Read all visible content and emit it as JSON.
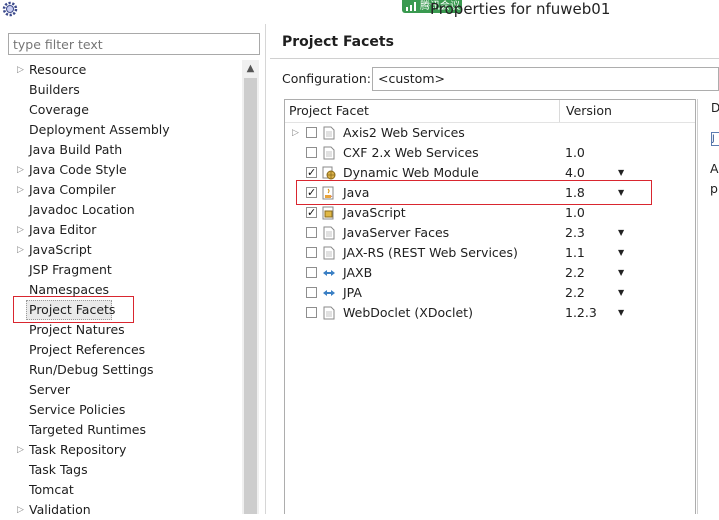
{
  "window": {
    "title": "Properties for nfuweb01",
    "meeting_badge": "腾讯会议"
  },
  "filter": {
    "placeholder": "type filter text"
  },
  "tree": [
    {
      "label": "Resource",
      "expandable": true
    },
    {
      "label": "Builders",
      "expandable": false
    },
    {
      "label": "Coverage",
      "expandable": false
    },
    {
      "label": "Deployment Assembly",
      "expandable": false
    },
    {
      "label": "Java Build Path",
      "expandable": false
    },
    {
      "label": "Java Code Style",
      "expandable": true
    },
    {
      "label": "Java Compiler",
      "expandable": true
    },
    {
      "label": "Javadoc Location",
      "expandable": false
    },
    {
      "label": "Java Editor",
      "expandable": true
    },
    {
      "label": "JavaScript",
      "expandable": true
    },
    {
      "label": "JSP Fragment",
      "expandable": false
    },
    {
      "label": "Namespaces",
      "expandable": false
    },
    {
      "label": "Project Facets",
      "expandable": false,
      "selected": true
    },
    {
      "label": "Project Natures",
      "expandable": false
    },
    {
      "label": "Project References",
      "expandable": false
    },
    {
      "label": "Run/Debug Settings",
      "expandable": false
    },
    {
      "label": "Server",
      "expandable": false
    },
    {
      "label": "Service Policies",
      "expandable": false
    },
    {
      "label": "Targeted Runtimes",
      "expandable": false
    },
    {
      "label": "Task Repository",
      "expandable": true
    },
    {
      "label": "Task Tags",
      "expandable": false
    },
    {
      "label": "Tomcat",
      "expandable": false
    },
    {
      "label": "Validation",
      "expandable": true
    }
  ],
  "page": {
    "title": "Project Facets",
    "configuration_label": "Configuration:",
    "configuration_value": "<custom>"
  },
  "facets_table": {
    "columns": [
      "Project Facet",
      "Version"
    ],
    "rows": [
      {
        "name": "Axis2 Web Services",
        "version": "",
        "checked": false,
        "expandable": true,
        "has_dropdown": false,
        "icon": "document-icon"
      },
      {
        "name": "CXF 2.x Web Services",
        "version": "1.0",
        "checked": false,
        "expandable": false,
        "has_dropdown": false,
        "icon": "document-icon"
      },
      {
        "name": "Dynamic Web Module",
        "version": "4.0",
        "checked": true,
        "expandable": false,
        "has_dropdown": true,
        "icon": "web-module-icon"
      },
      {
        "name": "Java",
        "version": "1.8",
        "checked": true,
        "expandable": false,
        "has_dropdown": true,
        "icon": "java-facet-icon"
      },
      {
        "name": "JavaScript",
        "version": "1.0",
        "checked": true,
        "expandable": false,
        "has_dropdown": false,
        "icon": "javascript-facet-icon"
      },
      {
        "name": "JavaServer Faces",
        "version": "2.3",
        "checked": false,
        "expandable": false,
        "has_dropdown": true,
        "icon": "document-icon"
      },
      {
        "name": "JAX-RS (REST Web Services)",
        "version": "1.1",
        "checked": false,
        "expandable": false,
        "has_dropdown": true,
        "icon": "document-icon"
      },
      {
        "name": "JAXB",
        "version": "2.2",
        "checked": false,
        "expandable": false,
        "has_dropdown": true,
        "icon": "jaxb-icon"
      },
      {
        "name": "JPA",
        "version": "2.2",
        "checked": false,
        "expandable": false,
        "has_dropdown": true,
        "icon": "jpa-icon"
      },
      {
        "name": "WebDoclet (XDoclet)",
        "version": "1.2.3",
        "checked": false,
        "expandable": false,
        "has_dropdown": true,
        "icon": "document-icon"
      }
    ]
  },
  "details_tab": {
    "label_fragment": "D",
    "icon_fragment": "J",
    "text1": "A",
    "text2": "p"
  },
  "colors": {
    "highlight_box": "#d9262f",
    "meeting_green": "#3a9a50"
  }
}
